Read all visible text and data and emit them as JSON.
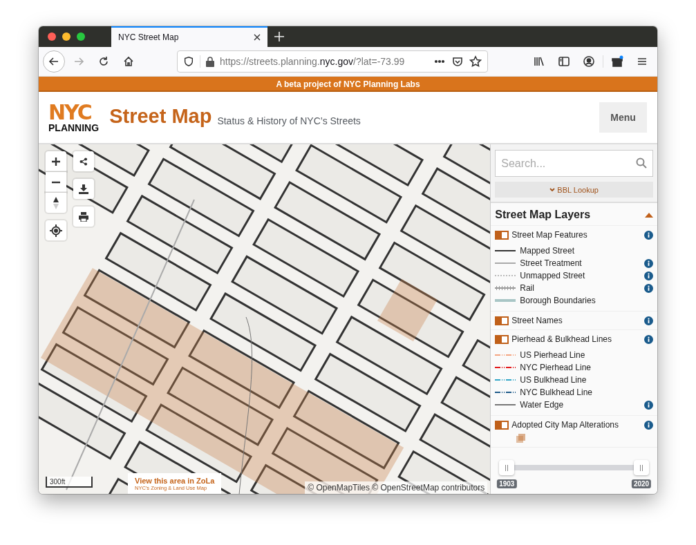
{
  "browser": {
    "tab_title": "NYC Street Map",
    "url": {
      "prefix": "https://streets.planning.",
      "domain": "nyc.gov",
      "path": "/?lat=-73.99"
    }
  },
  "banner": "A beta project of NYC Planning Labs",
  "header": {
    "logo_top": "NYC",
    "logo_bottom": "PLANNING",
    "title": "Street Map",
    "subtitle": "Status & History of NYC’s Streets",
    "menu_button": "Menu"
  },
  "map": {
    "scale": "300ft",
    "zola_link": {
      "title": "View this area in ZoLa",
      "subtitle": "NYC’s Zoning & Land Use Map"
    },
    "attribution": "© OpenMapTiles © OpenStreetMap contributors"
  },
  "sidebar": {
    "search": {
      "placeholder": "Search..."
    },
    "bbl_lookup": "BBL Lookup",
    "layers_title": "Street Map Layers",
    "expanded": true,
    "groups": [
      {
        "label": "Street Map Features",
        "on": true,
        "info": true,
        "legend": [
          {
            "label": "Mapped Street",
            "kind": "solid",
            "color": "#333333",
            "info": false
          },
          {
            "label": "Street Treatment",
            "kind": "solid",
            "color": "#aaaaaa",
            "info": true
          },
          {
            "label": "Unmapped Street",
            "kind": "dotted",
            "color": "#bbbbbb",
            "info": true
          },
          {
            "label": "Rail",
            "kind": "ticked",
            "color": "#999999",
            "info": true
          },
          {
            "label": "Borough Boundaries",
            "kind": "thick",
            "color": "#a9c6c6",
            "info": false
          }
        ]
      },
      {
        "label": "Street Names",
        "on": true,
        "info": true
      },
      {
        "label": "Pierhead & Bulkhead Lines",
        "on": true,
        "info": true,
        "legend": [
          {
            "label": "US Pierhead Line",
            "kind": "dashdot",
            "color": "#f4a582",
            "info": false
          },
          {
            "label": "NYC Pierhead Line",
            "kind": "dashdot",
            "color": "#e31a1c",
            "info": false
          },
          {
            "label": "US Bulkhead Line",
            "kind": "dashdot",
            "color": "#33a7c8",
            "info": false
          },
          {
            "label": "NYC Bulkhead Line",
            "kind": "dashdot",
            "color": "#1f5b8a",
            "info": false
          },
          {
            "label": "Water Edge",
            "kind": "solid",
            "color": "#777777",
            "info": true
          }
        ]
      },
      {
        "label": "Adopted City Map Alterations",
        "on": true,
        "info": true,
        "swatch": true
      }
    ],
    "year_range": {
      "low": {
        "level": 0,
        "label": "1903"
      },
      "high": {
        "level": 1,
        "label": "2020"
      }
    }
  }
}
